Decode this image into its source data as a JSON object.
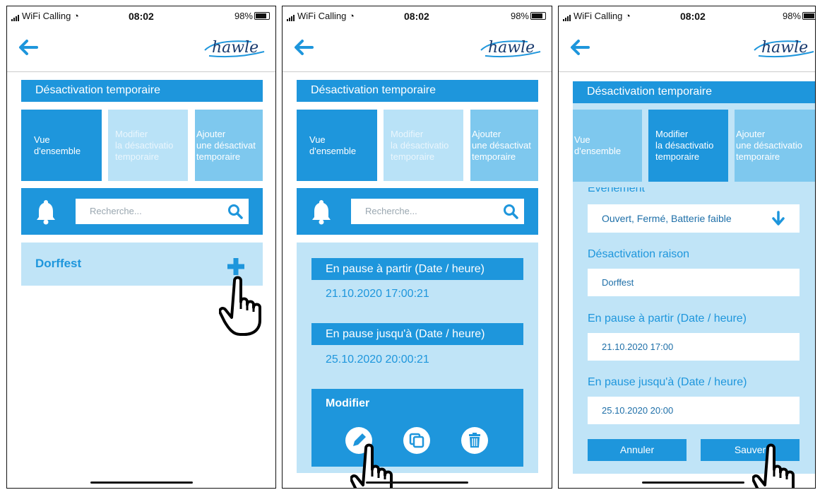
{
  "colors": {
    "accent": "#1e96dc",
    "panel": "#c0e4f7",
    "tile_mid": "#b9e2f7",
    "tile_light": "#7ec8ee"
  },
  "status": {
    "carrier": "WiFi Calling",
    "time": "08:02",
    "battery": "98%"
  },
  "brand": "hawle",
  "icons": {
    "back": "arrow-left-icon",
    "bell": "bell-icon",
    "search": "search-icon",
    "add": "plus-icon",
    "edit": "pencil-icon",
    "copy": "copy-icon",
    "delete": "trash-icon",
    "dropdown": "arrow-down-icon",
    "pointer": "hand-pointer-icon"
  },
  "screens": [
    {
      "title": "Désactivation temporaire",
      "tabs": [
        {
          "label": "Vue\nd'ensemble"
        },
        {
          "label": "Modifier\nla désactivatio\ntemporaire"
        },
        {
          "label": "Ajouter\nune désactivat\ntemporaire"
        }
      ],
      "search_placeholder": "Recherche...",
      "list": [
        {
          "name": "Dorffest"
        }
      ]
    },
    {
      "title": "Désactivation temporaire",
      "tabs": [
        {
          "label": "Vue\nd'ensemble"
        },
        {
          "label": "Modifier\nla désactivatio\ntemporaire"
        },
        {
          "label": "Ajouter\nune désactivat\ntemporaire"
        }
      ],
      "search_placeholder": "Recherche...",
      "from_label": "En pause à partir (Date / heure)",
      "from_value": "21.10.2020 17:00:21",
      "until_label": "En pause jusqu'à (Date / heure)",
      "until_value": "25.10.2020 20:00:21",
      "modify_label": "Modifier"
    },
    {
      "title": "Désactivation temporaire",
      "tabs": [
        {
          "label": "Vue\nd'ensemble"
        },
        {
          "label": "Modifier\nla désactivatio\ntemporaire"
        },
        {
          "label": "Ajouter\nune désactivatio\ntemporaire"
        }
      ],
      "event_label": "Evénement",
      "event_value": "Ouvert, Fermé, Batterie faible",
      "reason_label": "Désactivation raison",
      "reason_value": "Dorffest",
      "from_label": "En pause à partir (Date / heure)",
      "from_value": "21.10.2020 17:00",
      "until_label": "En pause jusqu'à (Date / heure)",
      "until_value": "25.10.2020 20:00",
      "cancel_label": "Annuler",
      "save_label": "Sauver"
    }
  ]
}
